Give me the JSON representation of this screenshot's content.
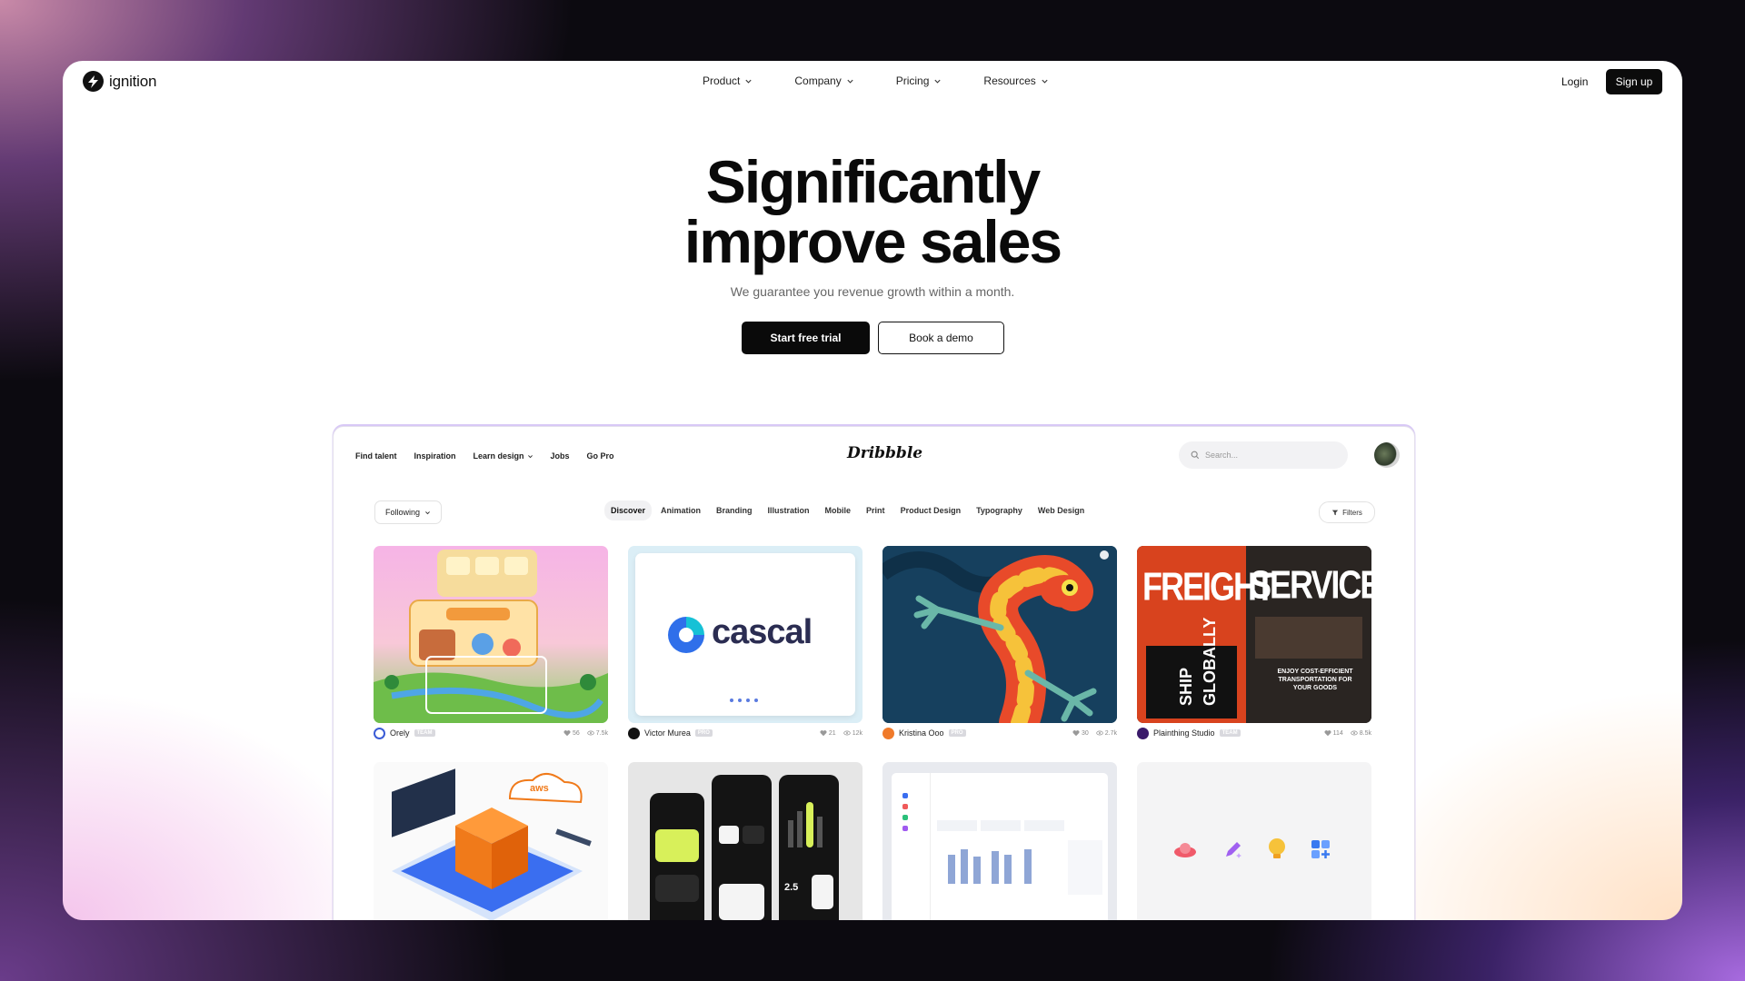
{
  "site": {
    "brand": "ignition",
    "nav": [
      "Product",
      "Company",
      "Pricing",
      "Resources"
    ],
    "login": "Login",
    "signup": "Sign up"
  },
  "hero": {
    "title_line1": "Significantly",
    "title_line2": "improve sales",
    "subtitle": "We guarantee you revenue growth within a month.",
    "primary_cta": "Start free trial",
    "secondary_cta": "Book a demo"
  },
  "dribbble": {
    "logo": "Dribbble",
    "nav": [
      "Find talent",
      "Inspiration",
      "Learn design",
      "Jobs",
      "Go Pro"
    ],
    "search_placeholder": "Search...",
    "following": "Following",
    "categories": [
      "Discover",
      "Animation",
      "Branding",
      "Illustration",
      "Mobile",
      "Print",
      "Product Design",
      "Typography",
      "Web Design"
    ],
    "active_category": "Discover",
    "filters": "Filters",
    "shots": [
      {
        "author": "Orely",
        "badge": "TEAM",
        "likes": "56",
        "views": "7.5k"
      },
      {
        "author": "Victor Murea",
        "badge": "PRO",
        "likes": "21",
        "views": "12k",
        "art_text": "cascal"
      },
      {
        "author": "Kristina Ooo",
        "badge": "PRO",
        "likes": "30",
        "views": "2.7k"
      },
      {
        "author": "Plainthing Studio",
        "badge": "TEAM",
        "likes": "114",
        "views": "8.5k",
        "art_text": [
          "FREIGHT",
          "SERVICES",
          "SHIP",
          "GLOBALLY",
          "ENJOY COST-EFFICIENT TRANSPORTATION FOR YOUR GOODS"
        ]
      }
    ],
    "second_row_text": {
      "aws": "aws",
      "phone_time": "2.5"
    }
  },
  "colors": {
    "accent": "#0a0a0a",
    "page_bg": "#0c0a10",
    "frame_glow_left": "#eb96dc",
    "frame_glow_right": "#ffc896"
  }
}
